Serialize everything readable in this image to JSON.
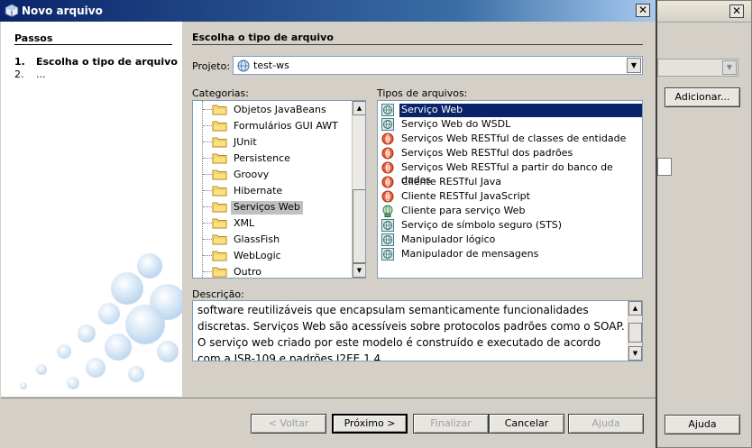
{
  "window": {
    "title": "Novo arquivo",
    "close_glyph": "✕"
  },
  "background_window": {
    "adicionar_label": "Adicionar...",
    "ajuda_label": "Ajuda",
    "close_glyph": "✕"
  },
  "steps": {
    "title": "Passos",
    "items": [
      {
        "num": "1.",
        "label": "Escolha o tipo de arquivo"
      },
      {
        "num": "2.",
        "label": "..."
      }
    ]
  },
  "content": {
    "title": "Escolha o tipo de arquivo",
    "projeto_label": "Projeto:",
    "projeto_value": "test-ws",
    "categorias_label": "Categorias:",
    "tipos_label": "Tipos de arquivos:",
    "descricao_label": "Descrição:"
  },
  "categories": [
    {
      "label": "Objetos JavaBeans",
      "icon": "folder-icon"
    },
    {
      "label": "Formulários GUI AWT",
      "icon": "folder-icon"
    },
    {
      "label": "JUnit",
      "icon": "folder-icon"
    },
    {
      "label": "Persistence",
      "icon": "folder-icon"
    },
    {
      "label": "Groovy",
      "icon": "folder-icon"
    },
    {
      "label": "Hibernate",
      "icon": "folder-icon"
    },
    {
      "label": "Serviços Web",
      "icon": "folder-icon",
      "selected": true
    },
    {
      "label": "XML",
      "icon": "folder-icon"
    },
    {
      "label": "GlassFish",
      "icon": "folder-icon"
    },
    {
      "label": "WebLogic",
      "icon": "folder-icon"
    },
    {
      "label": "Outro",
      "icon": "folder-icon"
    }
  ],
  "file_types": [
    {
      "label": "Serviço Web",
      "icon": "web-service-icon",
      "selected": true
    },
    {
      "label": "Serviço Web do WSDL",
      "icon": "web-service-icon"
    },
    {
      "label": "Serviços Web RESTful de classes de entidade",
      "icon": "rest-service-icon"
    },
    {
      "label": "Serviços Web RESTful dos padrões",
      "icon": "rest-service-icon"
    },
    {
      "label": "Serviços Web RESTful a partir do banco de dados",
      "icon": "rest-service-icon"
    },
    {
      "label": "Cliente RESTful Java",
      "icon": "rest-service-icon"
    },
    {
      "label": "Cliente RESTful JavaScript",
      "icon": "rest-service-icon"
    },
    {
      "label": "Cliente para serviço Web",
      "icon": "web-client-icon"
    },
    {
      "label": "Serviço de símbolo seguro (STS)",
      "icon": "web-service-icon"
    },
    {
      "label": "Manipulador lógico",
      "icon": "web-service-icon"
    },
    {
      "label": "Manipulador de mensagens",
      "icon": "web-service-icon"
    }
  ],
  "description": "software reutilizáveis que encapsulam semanticamente funcionalidades discretas. Serviços Web são acessíveis sobre protocolos padrões como o SOAP. O serviço web criado por este modelo é construído e executado de acordo com a JSR-109 e padrões J2EE 1.4.",
  "buttons": {
    "voltar": "< Voltar",
    "proximo": "Próximo >",
    "finalizar": "Finalizar",
    "cancelar": "Cancelar",
    "ajuda": "Ajuda"
  },
  "colors": {
    "titlebar": "#0a246a",
    "selection": "#0a246a",
    "category_selection": "#c0c0c0",
    "folder": "#ffe080"
  }
}
